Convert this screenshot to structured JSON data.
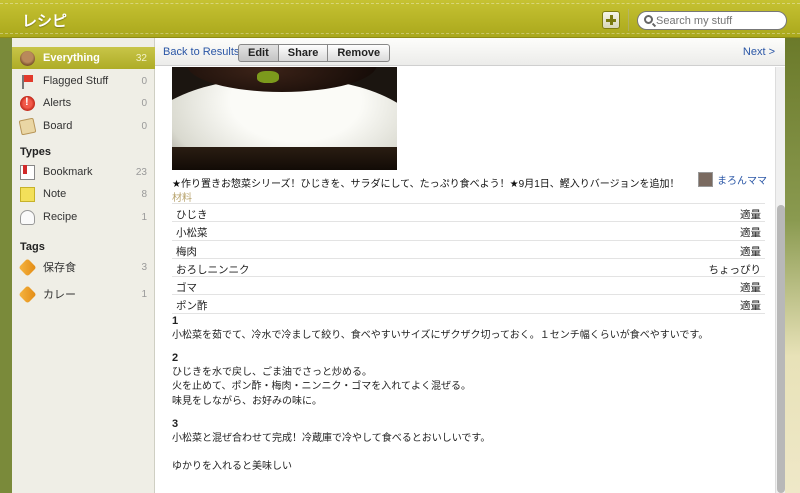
{
  "header": {
    "title": "レシピ",
    "search_placeholder": "Search my stuff"
  },
  "sidebar": {
    "items": [
      {
        "label": "Everything",
        "count": "32",
        "icon": "everything-icon"
      },
      {
        "label": "Flagged Stuff",
        "count": "0",
        "icon": "flag-icon"
      },
      {
        "label": "Alerts",
        "count": "0",
        "icon": "alert-icon"
      },
      {
        "label": "Board",
        "count": "0",
        "icon": "board-icon"
      }
    ],
    "types_heading": "Types",
    "types": [
      {
        "label": "Bookmark",
        "count": "23",
        "icon": "bookmark-icon"
      },
      {
        "label": "Note",
        "count": "8",
        "icon": "note-icon"
      },
      {
        "label": "Recipe",
        "count": "1",
        "icon": "recipe-icon"
      }
    ],
    "tags_heading": "Tags",
    "tags": [
      {
        "label": "保存食",
        "count": "3",
        "icon": "tag-icon"
      },
      {
        "label": "カレー",
        "count": "1",
        "icon": "tag-icon"
      }
    ]
  },
  "toolbar": {
    "back": "Back to Results",
    "edit": "Edit",
    "share": "Share",
    "remove": "Remove",
    "next": "Next >"
  },
  "recipe": {
    "description": "★作り置きお惣菜シリーズ！ひじきを、サラダにして、たっぷり食べよう！★9月1日、鰹入りバージョンを追加！",
    "author": "まろんママ",
    "ingredients_title": "材料",
    "ingredients": [
      {
        "name": "ひじき",
        "qty": "適量"
      },
      {
        "name": "小松菜",
        "qty": "適量"
      },
      {
        "name": "梅肉",
        "qty": "適量"
      },
      {
        "name": "おろしニンニク",
        "qty": "ちょっぴり"
      },
      {
        "name": "ゴマ",
        "qty": "適量"
      },
      {
        "name": "ポン酢",
        "qty": "適量"
      }
    ],
    "steps": [
      {
        "num": "1",
        "lines": [
          "小松菜を茹でて、冷水で冷まして絞り、食べやすいサイズにザクザク切っておく。１センチ幅くらいが食べやすいです。"
        ]
      },
      {
        "num": "2",
        "lines": [
          "ひじきを水で戻し、ごま油でさっと炒める。",
          "火を止めて、ポン酢・梅肉・ニンニク・ゴマを入れてよく混ぜる。",
          "味見をしながら、お好みの味に。"
        ]
      },
      {
        "num": "3",
        "lines": [
          "小松菜と混ぜ合わせて完成！冷蔵庫で冷やして食べるとおいしいです。"
        ]
      }
    ],
    "note": "ゆかりを入れると美味しい"
  }
}
